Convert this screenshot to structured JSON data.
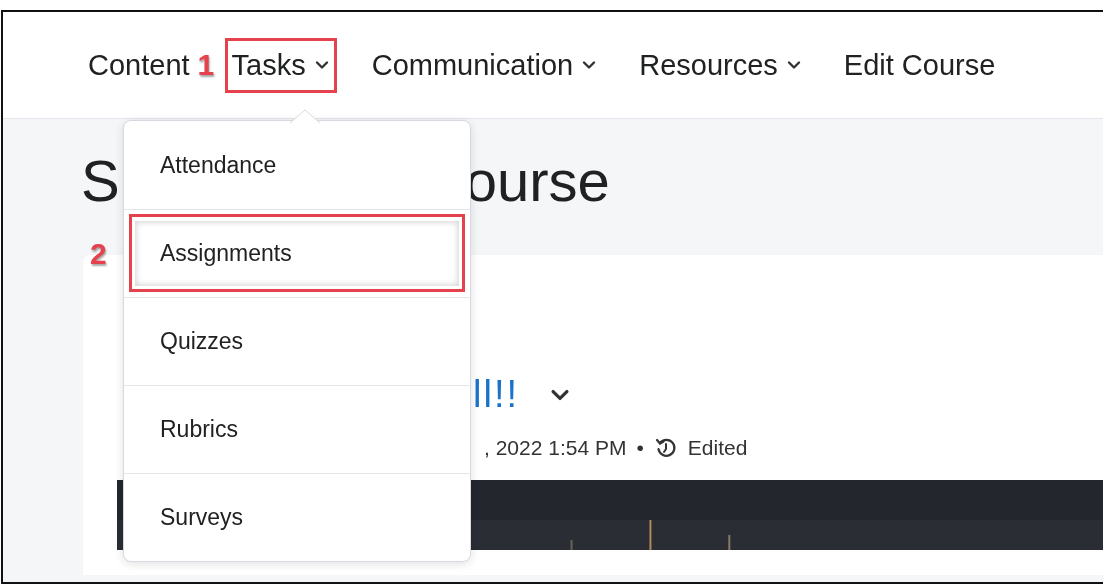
{
  "nav": [
    {
      "label": "Content",
      "has_menu": false
    },
    {
      "label": "Tasks",
      "has_menu": true,
      "callout": "1"
    },
    {
      "label": "Communication",
      "has_menu": true
    },
    {
      "label": "Resources",
      "has_menu": true
    },
    {
      "label": "Edit Course",
      "has_menu": false
    }
  ],
  "menu": [
    {
      "label": "Attendance",
      "outlined": false
    },
    {
      "label": "Assignments",
      "outlined": true,
      "callout": "2"
    },
    {
      "label": "Quizzes",
      "outlined": false
    },
    {
      "label": "Rubrics",
      "outlined": false
    },
    {
      "label": "Surveys",
      "outlined": false
    }
  ],
  "page_title_parts": [
    "S",
    "ourse"
  ],
  "post": {
    "title_fragment": "ll!!",
    "meta_fragment": ", 2022 1:54 PM",
    "separator": "•",
    "status": "Edited"
  }
}
